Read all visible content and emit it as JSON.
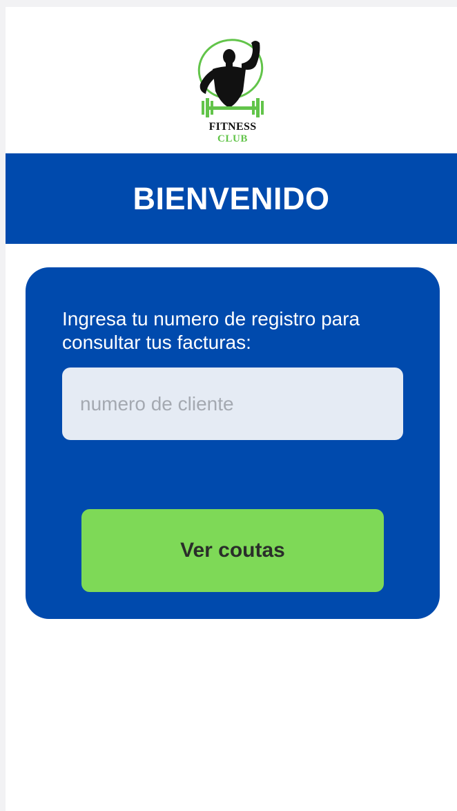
{
  "logo": {
    "line1": "FITNESS",
    "line2": "CLUB",
    "icon": "bodybuilder-dumbbell-icon",
    "colors": {
      "figure": "#111111",
      "accent": "#62c44a"
    }
  },
  "banner": {
    "title": "BIENVENIDO",
    "background": "#004aad"
  },
  "card": {
    "prompt": "Ingresa tu numero de registro para consultar tus facturas:",
    "input": {
      "value": "",
      "placeholder": "numero de cliente"
    },
    "button": {
      "label": "Ver coutas",
      "background": "#7ed957"
    }
  }
}
